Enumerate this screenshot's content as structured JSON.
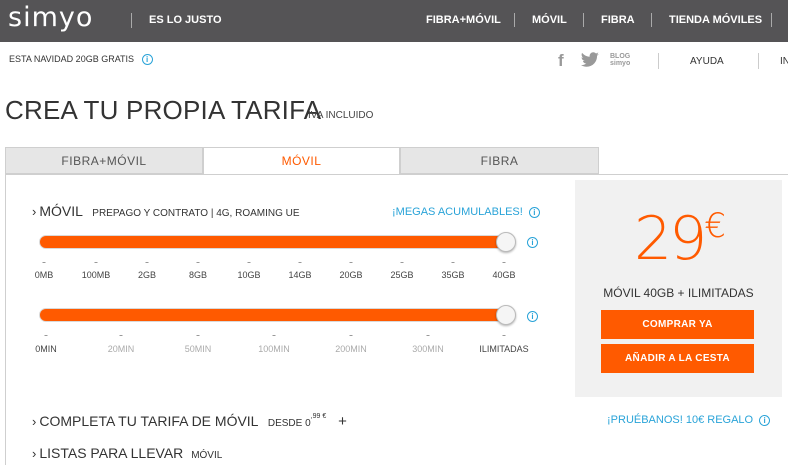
{
  "header": {
    "logo": "simyo",
    "slogan": "ES LO JUSTO",
    "nav": [
      "FIBRA+MÓVIL",
      "MÓVIL",
      "FIBRA",
      "TIENDA MÓVILES"
    ]
  },
  "subheader": {
    "promo": "ESTA NAVIDAD 20GB GRATIS",
    "blog_line1": "BLOG",
    "blog_line2": "simyo",
    "help": "AYUDA",
    "more": "IN"
  },
  "page": {
    "title": "CREA TU PROPIA TARIFA",
    "iva": "IVA INCLUIDO"
  },
  "tabs": [
    {
      "label": "FIBRA+MÓVIL",
      "active": false
    },
    {
      "label": "MÓVIL",
      "active": true
    },
    {
      "label": "FIBRA",
      "active": false
    }
  ],
  "movil": {
    "title": "MÓVIL",
    "subtitle": "PREPAGO Y CONTRATO | 4G, ROAMING UE",
    "megas_link": "¡MEGAS ACUMULABLES!",
    "data_slider": {
      "value": "40GB",
      "ticks": [
        "0MB",
        "100MB",
        "2GB",
        "8GB",
        "10GB",
        "14GB",
        "20GB",
        "25GB",
        "35GB",
        "40GB"
      ]
    },
    "minutes_slider": {
      "value": "ILIMITADAS",
      "ticks": [
        "0MIN",
        "20MIN",
        "50MIN",
        "100MIN",
        "200MIN",
        "300MIN",
        "ILIMITADAS"
      ]
    }
  },
  "price_box": {
    "amount": "29",
    "currency": "€",
    "plan": "MÓVIL 40GB + ILIMITADAS",
    "buy": "COMPRAR YA",
    "add_cart": "AÑADIR A LA CESTA"
  },
  "complete": {
    "title": "COMPLETA TU TARIFA DE MÓVIL",
    "desde": "DESDE 0",
    "desde_cents": ",99 €",
    "plus": "+",
    "trial_link": "¡PRUÉBANOS! 10€ REGALO"
  },
  "lists": {
    "title": "LISTAS PARA LLEVAR",
    "sub": "MÓVIL"
  },
  "colors": {
    "accent": "#ff5a00",
    "header_bg": "#555456",
    "link": "#29a3d8"
  }
}
